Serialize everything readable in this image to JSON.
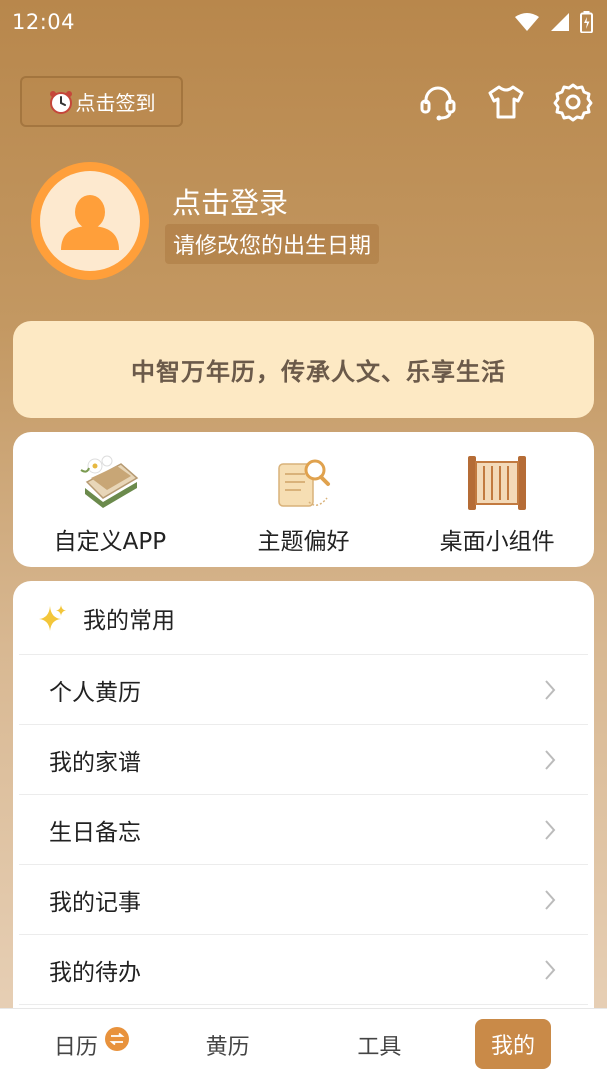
{
  "status_bar": {
    "time": "12:04"
  },
  "header": {
    "checkin_label": "点击签到",
    "checkin_icon": "alarm-clock-icon"
  },
  "profile": {
    "login_title": "点击登录",
    "birthday_hint": "请修改您的出生日期"
  },
  "slogan": "中智万年历，传承人文、乐享生活",
  "features": [
    {
      "label": "自定义APP",
      "icon": "book-flower-icon"
    },
    {
      "label": "主题偏好",
      "icon": "scroll-search-icon"
    },
    {
      "label": "桌面小组件",
      "icon": "scroll-frame-icon"
    }
  ],
  "common": {
    "title": "我的常用",
    "items": [
      {
        "label": "个人黄历"
      },
      {
        "label": "我的家谱"
      },
      {
        "label": "生日备忘"
      },
      {
        "label": "我的记事"
      },
      {
        "label": "我的待办"
      }
    ]
  },
  "bottom_nav": {
    "tabs": [
      {
        "label": "日历"
      },
      {
        "label": "黄历"
      },
      {
        "label": "工具"
      },
      {
        "label": "我的"
      }
    ],
    "active_tab": "我的"
  },
  "colors": {
    "avatar_orange": "#ff9f3a",
    "slogan_bg": "#fde9c4",
    "active_tab_bg": "#c98a48"
  }
}
